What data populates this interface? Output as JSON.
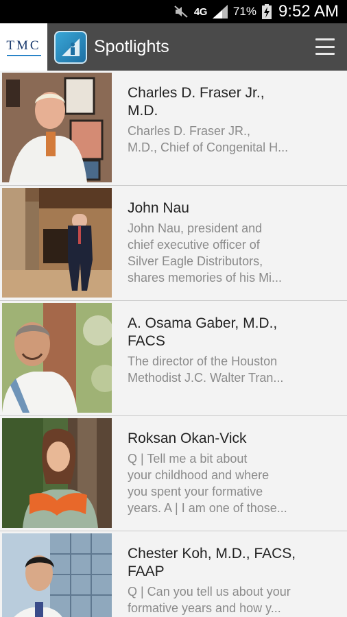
{
  "status_bar": {
    "network": "4G",
    "battery": "71%",
    "time": "9:52 AM"
  },
  "app_bar": {
    "brand": "TMC",
    "title": "Spotlights"
  },
  "spotlights": [
    {
      "title_lines": [
        "Charles D. Fraser Jr.,",
        "M.D."
      ],
      "summary_lines": [
        "Charles D. Fraser JR.,",
        "M.D., Chief of Congenital H..."
      ]
    },
    {
      "title_lines": [
        "John Nau"
      ],
      "summary_lines": [
        "John Nau, president and",
        "chief executive officer of",
        "Silver Eagle Distributors,",
        "shares memories of his Mi..."
      ]
    },
    {
      "title_lines": [
        "A. Osama Gaber, M.D.,",
        "FACS"
      ],
      "summary_lines": [
        "The director of the Houston",
        "Methodist J.C. Walter Tran..."
      ]
    },
    {
      "title_lines": [
        "Roksan Okan-Vick"
      ],
      "summary_lines": [
        "Q | Tell me a bit about",
        "your childhood and where",
        "you spent your formative",
        "years. A | I am one of those..."
      ]
    },
    {
      "title_lines": [
        "Chester Koh, M.D., FACS,",
        "FAAP"
      ],
      "summary_lines": [
        "Q | Can you tell us about your",
        "formative years and how y..."
      ]
    }
  ]
}
